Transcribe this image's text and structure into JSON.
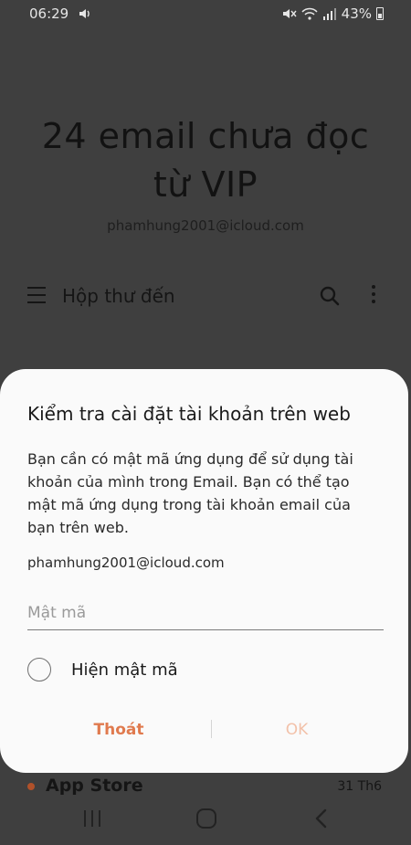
{
  "status_bar": {
    "time": "06:29",
    "battery": "43%",
    "icons": [
      "sound-icon",
      "mute-icon",
      "wifi-icon",
      "signal-icon",
      "battery-icon"
    ]
  },
  "background_app": {
    "title": "24 email chưa đọc từ VIP",
    "account": "phamhung2001@icloud.com",
    "folder": "Hộp thư đến",
    "list_item": {
      "sender": "App Store",
      "date": "31 Th6"
    }
  },
  "dialog": {
    "title": "Kiểm tra cài đặt tài khoản trên web",
    "message": "Bạn cần có mật mã ứng dụng để sử dụng tài khoản của mình trong Email. Bạn có thể tạo mật mã ứng dụng trong tài khoản email của bạn trên web.",
    "account": "phamhung2001@icloud.com",
    "password_placeholder": "Mật mã",
    "password_value": "",
    "show_password_label": "Hiện mật mã",
    "show_password_checked": false,
    "cancel_label": "Thoát",
    "ok_label": "OK"
  },
  "colors": {
    "accent": "#e07a4e",
    "accent_disabled": "#f2c1a9",
    "dialog_bg": "#fafafa",
    "scrim_bg": "#3f3f3f"
  }
}
